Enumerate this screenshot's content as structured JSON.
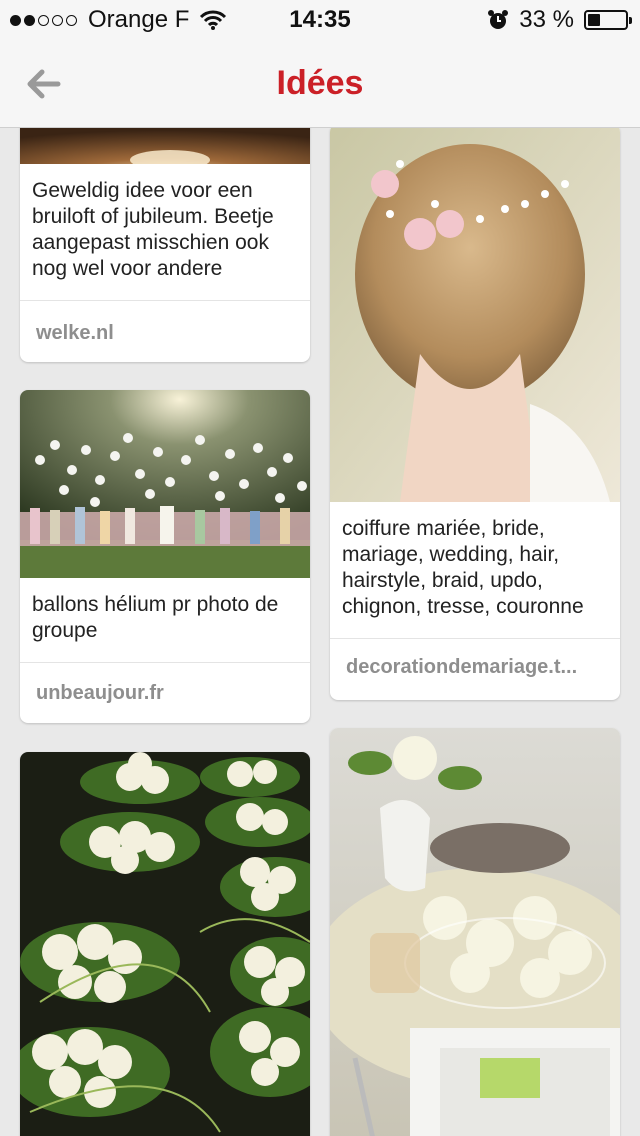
{
  "status_bar": {
    "signal_dots_filled": 2,
    "signal_dots_total": 5,
    "carrier": "Orange F",
    "wifi_icon": "wifi-icon",
    "time": "14:35",
    "alarm_icon": "alarm-icon",
    "battery_percent": "33 %",
    "battery_level": 0.33
  },
  "nav": {
    "back_icon": "back-arrow-icon",
    "title": "Idées",
    "title_color": "#cb2027"
  },
  "pins": [
    {
      "description": "Geweldig idee voor een bruiloft of jubileum. Beetje aangepast misschien ook nog wel voor andere",
      "source": "welke.nl",
      "image_subject": "table setting with candles"
    },
    {
      "description": "ballons hélium pr photo de groupe",
      "source": "unbeaujour.fr",
      "image_subject": "wedding group photo with white balloons"
    },
    {
      "description": "",
      "source": "",
      "image_subject": "white rose bouquets with calla lilies"
    },
    {
      "description": "coiffure mariée, bride, mariage, wedding, hair, hairstyle, braid, updo, chignon, tresse, couronne",
      "source": "decorationdemariage.t...",
      "image_subject": "bridal updo with flower crown"
    },
    {
      "description": "",
      "source": "",
      "image_subject": "table centerpiece with white roses in water"
    }
  ]
}
